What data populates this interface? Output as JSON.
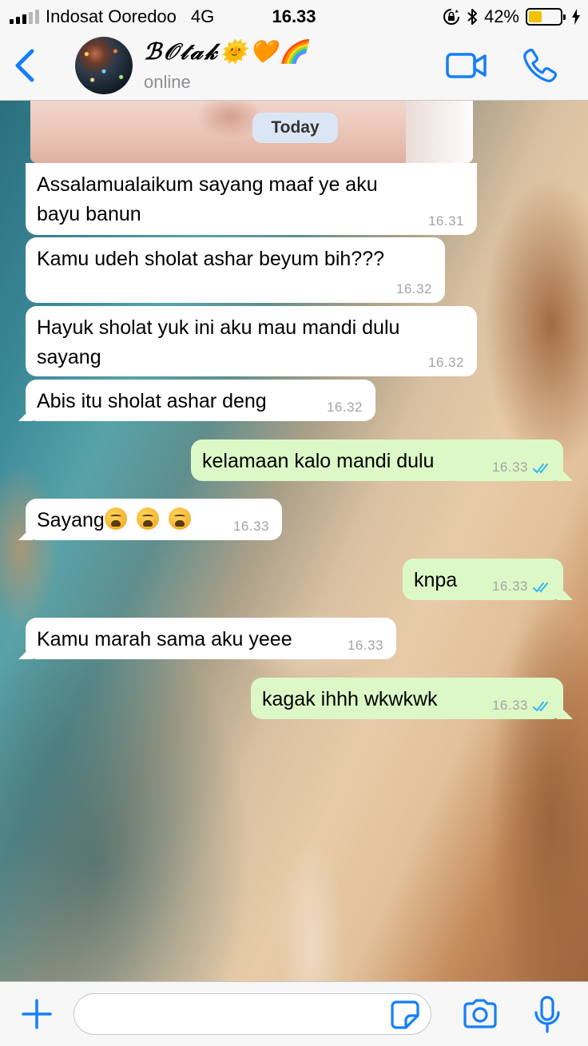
{
  "status_bar": {
    "carrier": "Indosat Ooredoo",
    "network": "4G",
    "time": "16.33",
    "battery_percent": "42%",
    "battery_level": 0.42,
    "icons": [
      "signal-icon",
      "lock-rotation-icon",
      "bluetooth-icon",
      "battery-icon",
      "charging-icon"
    ]
  },
  "header": {
    "contact_name": "ℬ𝒪𝓉𝒶𝓀🌞🧡🌈",
    "contact_status": "online",
    "icons": [
      "back-chevron-icon",
      "video-call-icon",
      "phone-call-icon"
    ],
    "accent_color": "#147efb"
  },
  "chat": {
    "date_label": "Today",
    "messages": [
      {
        "direction": "in",
        "text": "Assalamualaikum sayang maaf ye aku\nbayu banun",
        "time": "16.31"
      },
      {
        "direction": "in",
        "text": "Kamu udeh sholat ashar beyum bih???",
        "time": "16.32"
      },
      {
        "direction": "in",
        "text": "Hayuk sholat yuk ini aku mau mandi dulu\nsayang",
        "time": "16.32"
      },
      {
        "direction": "in",
        "text": "Abis itu sholat ashar deng",
        "time": "16.32"
      },
      {
        "direction": "out",
        "text": "kelamaan kalo mandi dulu",
        "time": "16.33",
        "read": true
      },
      {
        "direction": "in",
        "text": "Sayang",
        "emoji": "😩😩😩",
        "time": "16.33"
      },
      {
        "direction": "out",
        "text": "knpa",
        "time": "16.33",
        "read": true
      },
      {
        "direction": "in",
        "text": "Kamu marah sama aku yeee",
        "time": "16.33"
      },
      {
        "direction": "out",
        "text": "kagak ihhh wkwkwk",
        "time": "16.33",
        "read": true
      }
    ],
    "colors": {
      "incoming": "#ffffff",
      "outgoing": "#dcf8c6",
      "read_ticks": "#34b7f1"
    }
  },
  "input_bar": {
    "message_value": "",
    "icons": [
      "plus-icon",
      "sticker-icon",
      "camera-icon",
      "microphone-icon"
    ]
  }
}
